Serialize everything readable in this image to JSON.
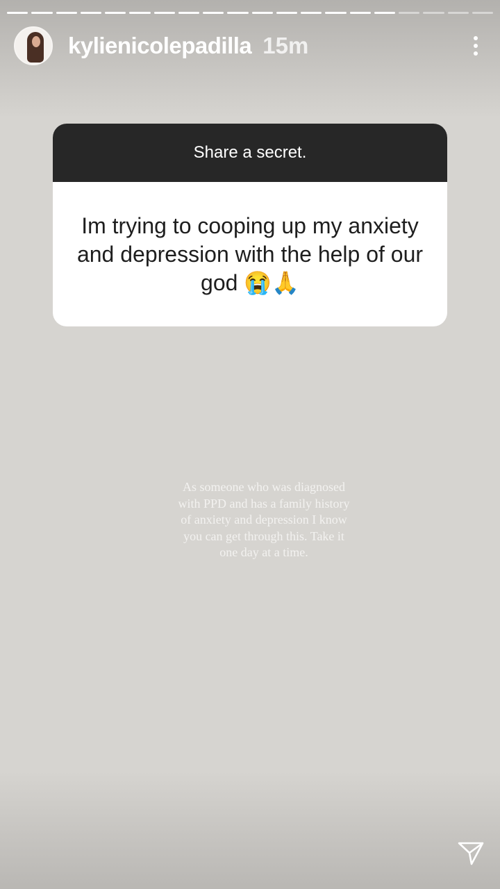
{
  "story": {
    "progress_segments": 20,
    "progress_viewed": 16,
    "username": "kylienicolepadilla",
    "time_ago": "15m"
  },
  "question_card": {
    "prompt": "Share a secret.",
    "answer": "Im trying to cooping up my anxiety and depression with the help of our god 😭🙏"
  },
  "reply_text": "As someone who was diagnosed with PPD and has a family history of anxiety and depression I know you can get through this. Take it one day at a time.",
  "icons": {
    "menu": "more-vertical-icon",
    "send": "send-icon"
  },
  "colors": {
    "background": "#d6d4d0",
    "card_header": "#272727",
    "card_body": "#ffffff"
  }
}
